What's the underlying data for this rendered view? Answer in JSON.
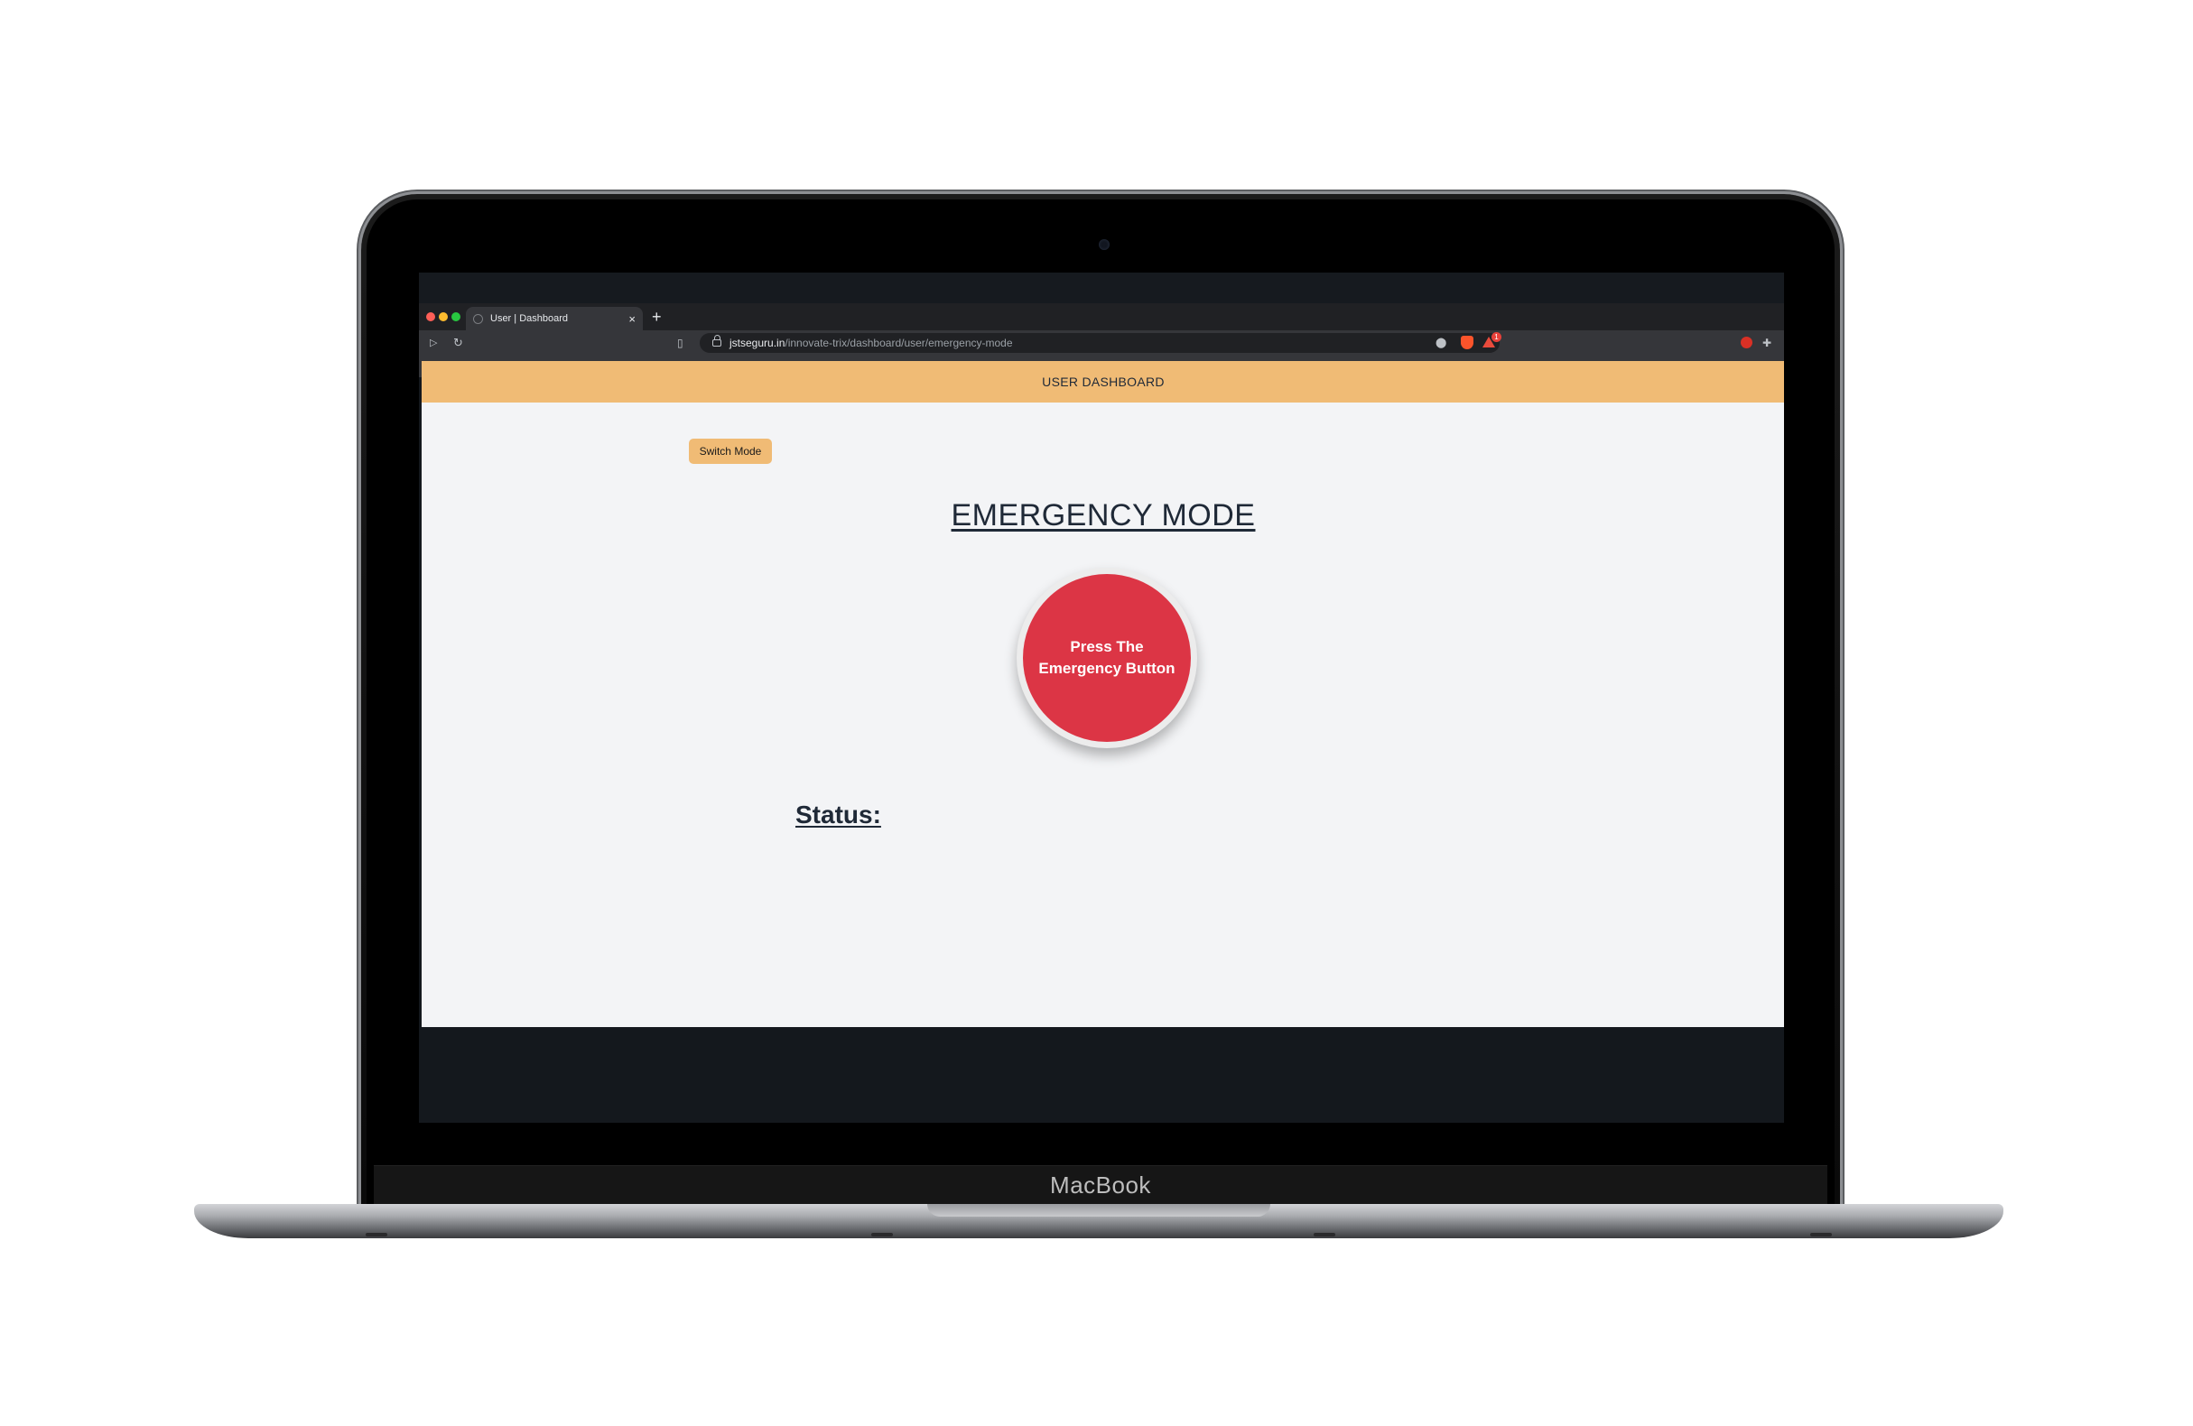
{
  "device": {
    "brand": "MacBook"
  },
  "browser": {
    "tab": {
      "title": "User | Dashboard",
      "close_glyph": "×"
    },
    "new_tab_glyph": "+",
    "url": {
      "host": "jstseguru.in",
      "path": "/innovate-trix/dashboard/user/emergency-mode"
    },
    "rewards_badge": "1"
  },
  "page": {
    "header_title": "USER DASHBOARD",
    "switch_mode_label": "Switch Mode",
    "heading": "EMERGENCY MODE",
    "emergency_button_label": "Press The Emergency Button",
    "status_label": "Status:"
  },
  "colors": {
    "header_bg": "#f0bb75",
    "emergency_red": "#dc3545",
    "page_bg": "#f3f4f6",
    "text_dark": "#1f2937"
  }
}
